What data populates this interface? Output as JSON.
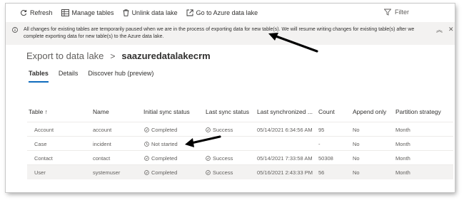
{
  "toolbar": {
    "refresh_label": "Refresh",
    "manage_label": "Manage tables",
    "unlink_label": "Unlink data lake",
    "azure_label": "Go to Azure data lake",
    "filter_label": "Filter"
  },
  "banner": {
    "message": "All changes for existing tables are temporarily paused when we are in the process of exporting data for new table(s). We will resume writing changes for existing table(s) after we complete exporting data for new table(s) to the Azure data lake."
  },
  "breadcrumb": {
    "root": "Export to data lake",
    "separator": ">",
    "current": "saazuredatalakecrm"
  },
  "tabs": [
    "Tables",
    "Details",
    "Discover hub (preview)"
  ],
  "grid": {
    "columns": [
      "Table ↑",
      "Name",
      "Initial sync status",
      "Last sync status",
      "Last synchronized ...",
      "Count",
      "Append only",
      "Partition strategy"
    ],
    "rows": [
      {
        "table": "Account",
        "name": "account",
        "initial": "Completed",
        "last": "Success",
        "synced": "05/14/2021 6:34:56 AM",
        "count": "95",
        "append": "No",
        "partition": "Month"
      },
      {
        "table": "Case",
        "name": "incident",
        "initial": "Not started",
        "last": "",
        "synced": "",
        "count": "-",
        "append": "No",
        "partition": "Month"
      },
      {
        "table": "Contact",
        "name": "contact",
        "initial": "Completed",
        "last": "Success",
        "synced": "05/14/2021 7:33:58 AM",
        "count": "50308",
        "append": "No",
        "partition": "Month"
      },
      {
        "table": "User",
        "name": "systemuser",
        "initial": "Completed",
        "last": "Success",
        "synced": "05/16/2021 2:43:33 PM",
        "count": "56",
        "append": "No",
        "partition": "Month"
      }
    ]
  },
  "colors": {
    "accent": "#0f6cbd",
    "banner_bg": "#f3f2f1",
    "arrow": "#000000"
  }
}
